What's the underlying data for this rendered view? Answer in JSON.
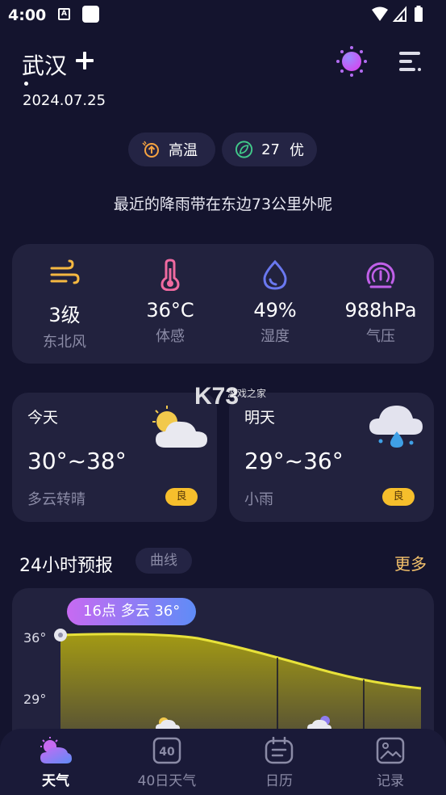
{
  "status": {
    "time": "4:00",
    "a_glyph": "A"
  },
  "header": {
    "city": "武汉",
    "date": "2024.07.25"
  },
  "chips": [
    {
      "label": "高温",
      "icon": "high-temp-icon",
      "color": "#f5a341"
    },
    {
      "value": "27",
      "label": "优",
      "icon": "leaf-icon",
      "color": "#41c98a"
    }
  ],
  "rain_note": "最近的降雨带在东边73公里外呢",
  "metrics": [
    {
      "value": "3级",
      "label": "东北风",
      "icon": "wind-icon",
      "color": "#f5b841"
    },
    {
      "value": "36°C",
      "label": "体感",
      "icon": "thermometer-icon",
      "color": "#f06aa0"
    },
    {
      "value": "49%",
      "label": "湿度",
      "icon": "humidity-drop-icon",
      "color": "#6a78f0"
    },
    {
      "value": "988hPa",
      "label": "气压",
      "icon": "pressure-gauge-icon",
      "color": "#c060e8"
    }
  ],
  "days": [
    {
      "title": "今天",
      "temp": "30°~38°",
      "condition": "多云转晴",
      "aqi": "良",
      "icon": "partly-cloudy-icon"
    },
    {
      "title": "明天",
      "temp": "29°~36°",
      "condition": "小雨",
      "aqi": "良",
      "icon": "light-rain-icon"
    }
  ],
  "watermark": {
    "logo": "K73",
    "sub": "游戏之家"
  },
  "forecast": {
    "title": "24小时预报",
    "mode_tab": "曲线",
    "more": "更多",
    "tooltip": "16点 多云 36°",
    "yticks": [
      "36°",
      "29°"
    ]
  },
  "colors": {
    "background": "#14142e",
    "card": "#22223e",
    "accent_gold": "#f5c26b",
    "aqi_badge": "#f6be2c"
  },
  "nav": [
    {
      "label": "天气",
      "icon": "weather-icon",
      "active": true
    },
    {
      "label": "40日天气",
      "icon": "forty-day-icon",
      "active": false
    },
    {
      "label": "日历",
      "icon": "calendar-icon",
      "active": false
    },
    {
      "label": "记录",
      "icon": "gallery-icon",
      "active": false
    }
  ]
}
